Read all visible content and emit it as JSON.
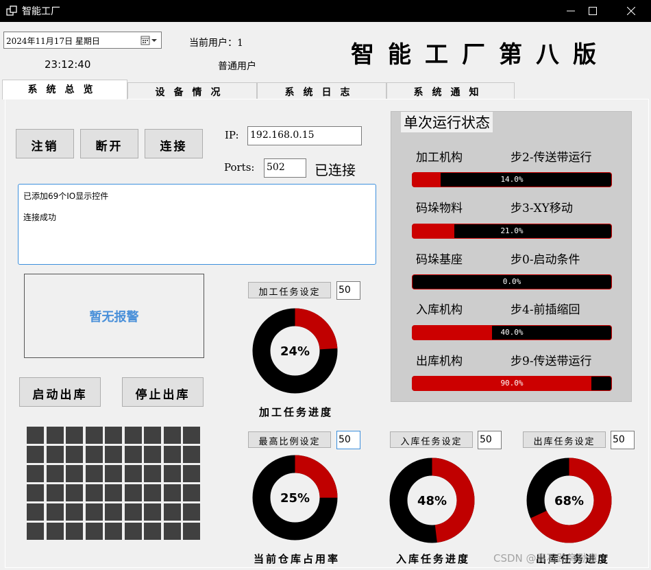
{
  "window": {
    "title": "智能工厂",
    "icon": "app-window-icon"
  },
  "header": {
    "date_value": "2024年11月17日  星期日",
    "time": "23:12:40",
    "current_user_label": "当前用户：1",
    "user_role": "普通用户",
    "big_title": "智能工厂第八版"
  },
  "tabs": [
    {
      "label": "系统总览",
      "active": true
    },
    {
      "label": "设备情况",
      "active": false
    },
    {
      "label": "系统日志",
      "active": false
    },
    {
      "label": "系统通知",
      "active": false
    }
  ],
  "controls": {
    "logout_label": "注销",
    "disconnect_label": "断开",
    "connect_label": "连接",
    "ip_label": "IP:",
    "ip_value": "192.168.0.15",
    "ports_label": "Ports:",
    "ports_value": "502",
    "connection_status": "已连接"
  },
  "log": {
    "lines": [
      "已添加69个IO显示控件",
      "连接成功"
    ]
  },
  "alarm": {
    "text": "暂无报警"
  },
  "outbound": {
    "start_label": "启动出库",
    "stop_label": "停止出库"
  },
  "io_grid": {
    "cells": 54
  },
  "tasks": {
    "process": {
      "set_label": "加工任务设定",
      "value": "50",
      "percent_text": "24%",
      "percent": 24,
      "caption": "加工任务进度"
    },
    "occupancy": {
      "set_label": "最高比例设定",
      "value": "50",
      "percent_text": "25%",
      "percent": 25,
      "caption": "当前仓库占用率"
    },
    "inbound": {
      "set_label": "入库任务设定",
      "value": "50",
      "percent_text": "48%",
      "percent": 48,
      "caption": "入库任务进度"
    },
    "outbound": {
      "set_label": "出库任务设定",
      "value": "50",
      "percent_text": "68%",
      "percent": 68,
      "caption": "出库任务进度"
    }
  },
  "run_status": {
    "title": "单次运行状态",
    "items": [
      {
        "name": "加工机构",
        "step": "步2-传送带运行",
        "percent": 14,
        "percent_text": "14.0%"
      },
      {
        "name": "码垛物料",
        "step": "步3-XY移动",
        "percent": 21,
        "percent_text": "21.0%"
      },
      {
        "name": "码垛基座",
        "step": "步0-启动条件",
        "percent": 0,
        "percent_text": "0.0%"
      },
      {
        "name": "入库机构",
        "step": "步4-前插缩回",
        "percent": 40,
        "percent_text": "40.0%"
      },
      {
        "name": "出库机构",
        "step": "步9-传送带运行",
        "percent": 90,
        "percent_text": "90.0%"
      }
    ]
  },
  "colors": {
    "accent_red": "#c00000",
    "ring_black": "#000000",
    "alarm_blue": "#4a90d9",
    "focus_blue": "#3c8fdc"
  },
  "watermark": "CSDN @青石路旁勋章"
}
